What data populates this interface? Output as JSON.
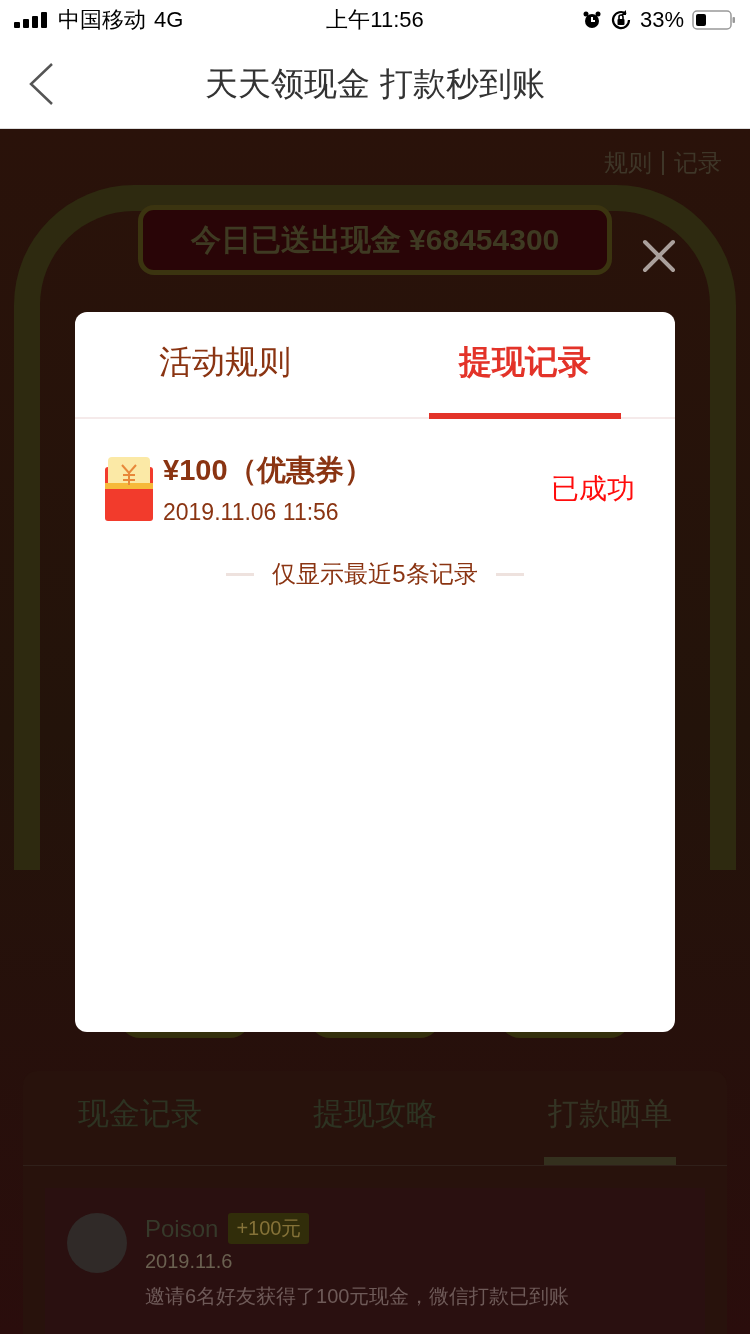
{
  "status_bar": {
    "carrier": "中国移动",
    "network": "4G",
    "time": "上午11:56",
    "battery": "33%"
  },
  "nav": {
    "title": "天天领现金 打款秒到账"
  },
  "background": {
    "links": [
      "规则",
      "记录"
    ],
    "banner": "今日已送出现金 ¥68454300",
    "tabs": [
      {
        "label": "现金记录",
        "selected": false
      },
      {
        "label": "提现攻略",
        "selected": false
      },
      {
        "label": "打款晒单",
        "selected": true
      }
    ],
    "feed": [
      {
        "name": "Poison",
        "badge": "+100元",
        "date": "2019.11.6",
        "text": "邀请6名好友获得了100元现金，微信打款已到账"
      }
    ]
  },
  "modal": {
    "tabs": [
      {
        "label": "活动规则",
        "selected": false
      },
      {
        "label": "提现记录",
        "selected": true
      }
    ],
    "records": [
      {
        "amount": "¥100（优惠券）",
        "time": "2019.11.06 11:56",
        "status": "已成功"
      }
    ],
    "footer_note": "仅显示最近5条记录"
  }
}
